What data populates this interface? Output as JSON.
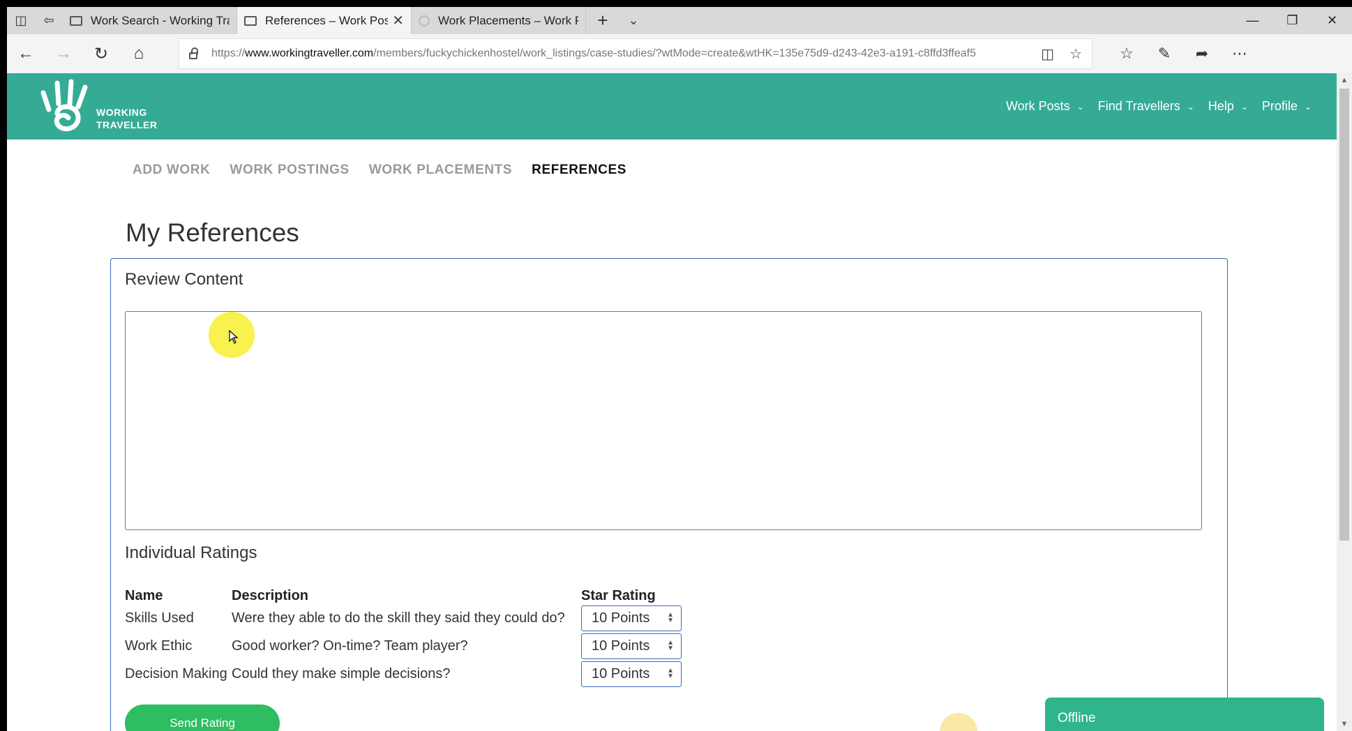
{
  "browser": {
    "tabs": [
      {
        "label": "Work Search - Working Trav",
        "active": false
      },
      {
        "label": "References – Work Post",
        "active": true
      },
      {
        "label": "Work Placements – Work Pc",
        "active": false
      }
    ],
    "url_prefix": "https://",
    "url_host": "www.workingtraveller.com",
    "url_path": "/members/fuckychickenhostel/work_listings/case-studies/?wtMode=create&wtHK=135e75d9-d243-42e3-a191-c8ffd3ffeaf5"
  },
  "site": {
    "logo_line1": "WORKING",
    "logo_line2": "TRAVELLER",
    "brand_color": "#35ab96",
    "nav": [
      {
        "label": "Work Posts"
      },
      {
        "label": "Find Travellers"
      },
      {
        "label": "Help"
      },
      {
        "label": "Profile"
      }
    ]
  },
  "subnav": [
    {
      "label": "ADD WORK",
      "active": false
    },
    {
      "label": "WORK POSTINGS",
      "active": false
    },
    {
      "label": "WORK PLACEMENTS",
      "active": false
    },
    {
      "label": "REFERENCES",
      "active": true
    }
  ],
  "page": {
    "title": "My References",
    "review_section_title": "Review Content",
    "review_value": "",
    "ratings_section_title": "Individual Ratings",
    "ratings_headers": {
      "name": "Name",
      "description": "Description",
      "star": "Star Rating"
    },
    "ratings": [
      {
        "name": "Skills Used",
        "description": "Were they able to do the skill they said they could do?",
        "value": "10 Points"
      },
      {
        "name": "Work Ethic",
        "description": "Good worker? On-time? Team player?",
        "value": "10 Points"
      },
      {
        "name": "Decision Making",
        "description": "Could they make simple decisions?",
        "value": "10 Points"
      }
    ],
    "send_button": "Send Rating"
  },
  "chat": {
    "status": "Offline",
    "color": "#2fb48c"
  },
  "colors": {
    "send_button": "#2fbd62",
    "card_border": "#3b6cb7"
  }
}
